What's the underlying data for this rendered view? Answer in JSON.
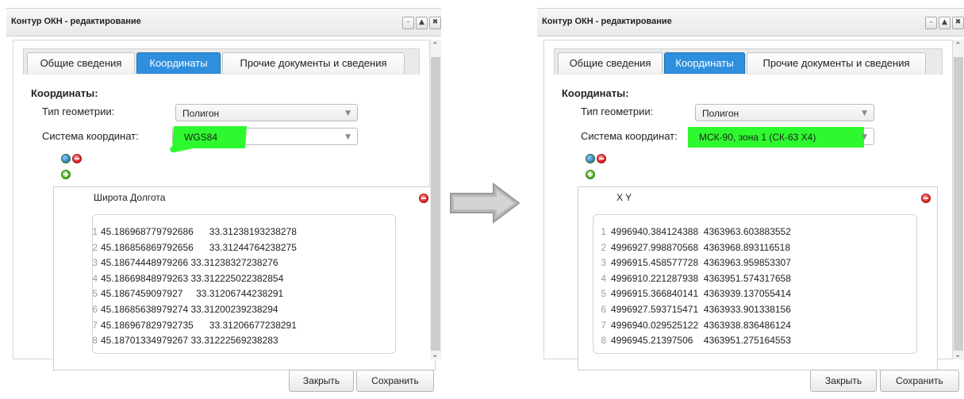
{
  "left": {
    "window_title": "Контур ОКН - редактирование",
    "window_buttons": [
      "–",
      "▲",
      "✖"
    ],
    "tabs": [
      "Общие сведения",
      "Координаты",
      "Прочие документы и сведения"
    ],
    "active_tab": 1,
    "section_title": "Координаты:",
    "geometry_label": "Тип геометрии:",
    "geometry_value": "Полигон",
    "crs_label": "Система координат:",
    "crs_value": "WGS84",
    "columns_header": "Широта  Долгота",
    "rows": [
      [
        "1",
        "45.186968779792686      33.31238193238278"
      ],
      [
        "2",
        "45.186856869792656      33.31244764238275"
      ],
      [
        "3",
        "45.18674448979266 33.31238327238276"
      ],
      [
        "4",
        "45.18669848979263 33.312225022382854"
      ],
      [
        "5",
        "45.1867459097927     33.31206744238291"
      ],
      [
        "6",
        "45.18685638979274 33.31200239238294"
      ],
      [
        "7",
        "45.186967829792735      33.31206677238291"
      ],
      [
        "8",
        "45.18701334979267 33.31222569238283"
      ]
    ],
    "close_button": "Закрыть",
    "save_button": "Сохранить"
  },
  "right": {
    "window_title": "Контур ОКН - редактирование",
    "window_buttons": [
      "–",
      "▲",
      "✖"
    ],
    "tabs": [
      "Общие сведения",
      "Координаты",
      "Прочие документы и сведения"
    ],
    "active_tab": 1,
    "section_title": "Координаты:",
    "geometry_label": "Тип геометрии:",
    "geometry_value": "Полигон",
    "crs_label": "Система координат:",
    "crs_value": "МСК-90, зона 1 (СК-63 Х4)",
    "columns_header": "X  Y",
    "rows": [
      [
        "1",
        "4996940.384124388  4363963.603883552"
      ],
      [
        "2",
        "4996927.998870568  4363968.893116518"
      ],
      [
        "3",
        "4996915.458577728  4363963.959853307"
      ],
      [
        "4",
        "4996910.221287938  4363951.574317658"
      ],
      [
        "5",
        "4996915.366840141  4363939.137055414"
      ],
      [
        "6",
        "4996927.593715471  4363933.901338156"
      ],
      [
        "7",
        "4996940.029525122  4363938.836486124"
      ],
      [
        "8",
        "4996945.21397506    4363951.275164553"
      ]
    ],
    "close_button": "Закрыть",
    "save_button": "Сохранить"
  },
  "colors": {
    "active_tab": "#2e8fde",
    "highlight": "#2ef92e",
    "arrow": "#b9b9b9"
  },
  "icons": [
    "globe-icon",
    "remove-icon",
    "add-icon",
    "delete-icon",
    "arrow-right-icon"
  ]
}
